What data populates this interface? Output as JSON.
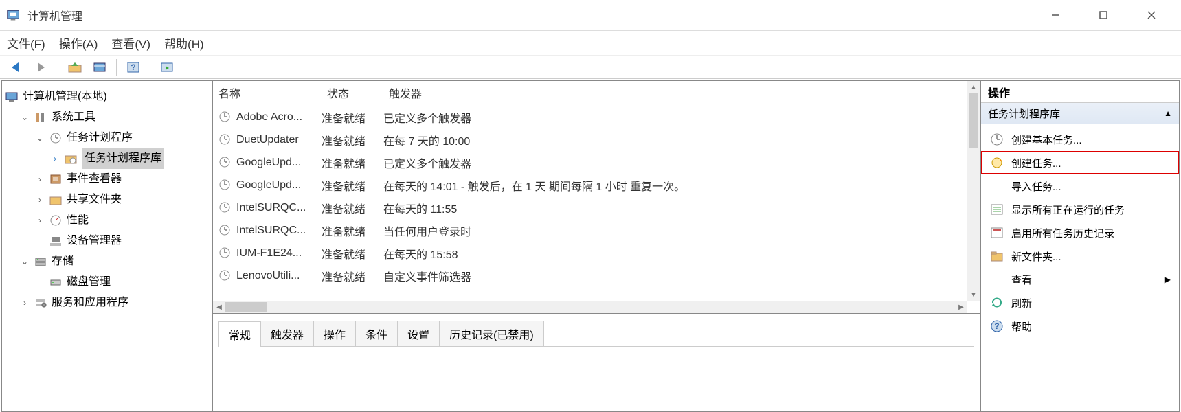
{
  "window": {
    "title": "计算机管理"
  },
  "menu": {
    "file": "文件(F)",
    "action": "操作(A)",
    "view": "查看(V)",
    "help": "帮助(H)"
  },
  "tree": {
    "root": "计算机管理(本地)",
    "system_tools": "系统工具",
    "task_scheduler": "任务计划程序",
    "task_scheduler_lib": "任务计划程序库",
    "event_viewer": "事件查看器",
    "shared_folders": "共享文件夹",
    "performance": "性能",
    "device_manager": "设备管理器",
    "storage": "存储",
    "disk_management": "磁盘管理",
    "services_apps": "服务和应用程序"
  },
  "task_list": {
    "headers": {
      "name": "名称",
      "state": "状态",
      "trigger": "触发器"
    },
    "rows": [
      {
        "name": "Adobe Acro...",
        "state": "准备就绪",
        "trigger": "已定义多个触发器"
      },
      {
        "name": "DuetUpdater",
        "state": "准备就绪",
        "trigger": "在每 7 天的 10:00"
      },
      {
        "name": "GoogleUpd...",
        "state": "准备就绪",
        "trigger": "已定义多个触发器"
      },
      {
        "name": "GoogleUpd...",
        "state": "准备就绪",
        "trigger": "在每天的 14:01 - 触发后，在 1 天 期间每隔 1 小时 重复一次。"
      },
      {
        "name": "IntelSURQC...",
        "state": "准备就绪",
        "trigger": "在每天的 11:55"
      },
      {
        "name": "IntelSURQC...",
        "state": "准备就绪",
        "trigger": "当任何用户登录时"
      },
      {
        "name": "IUM-F1E24...",
        "state": "准备就绪",
        "trigger": "在每天的 15:58"
      },
      {
        "name": "LenovoUtili...",
        "state": "准备就绪",
        "trigger": "自定义事件筛选器"
      }
    ]
  },
  "tabs": {
    "general": "常规",
    "triggers": "触发器",
    "actions": "操作",
    "conditions": "条件",
    "settings": "设置",
    "history": "历史记录(已禁用)"
  },
  "actions_panel": {
    "title": "操作",
    "section": "任务计划程序库",
    "items": {
      "create_basic": "创建基本任务...",
      "create_task": "创建任务...",
      "import_task": "导入任务...",
      "show_running": "显示所有正在运行的任务",
      "enable_history": "启用所有任务历史记录",
      "new_folder": "新文件夹...",
      "view": "查看",
      "refresh": "刷新",
      "help": "帮助"
    }
  }
}
